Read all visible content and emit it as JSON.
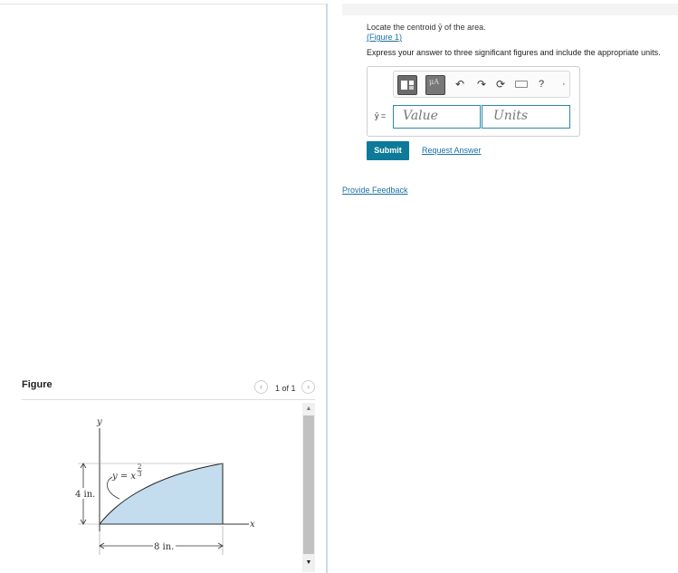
{
  "question": {
    "prompt": "Locate the centroid ȳ of the area.",
    "figure_link": "(Figure 1)",
    "instruction": "Express your answer to three significant figures and include the appropriate units."
  },
  "answer": {
    "variable_label": "ȳ =",
    "value_placeholder": "Value",
    "units_placeholder": "Units",
    "toolbar": {
      "template_icon": "templates-icon",
      "mu_label": "μA",
      "undo_icon": "undo-icon",
      "redo_icon": "redo-icon",
      "reset_icon": "reset-icon",
      "keyboard_icon": "keyboard-icon",
      "help_label": "?"
    }
  },
  "actions": {
    "submit_label": "Submit",
    "request_answer_label": "Request Answer",
    "provide_feedback_label": "Provide Feedback"
  },
  "figure_panel": {
    "title": "Figure",
    "page_label": "1 of 1",
    "prev_icon": "chevron-left-icon",
    "next_icon": "chevron-right-icon",
    "diagram": {
      "y_axis_label": "y",
      "x_axis_label": "x",
      "curve_equation_base": "y = x",
      "curve_equation_exp_num": "2",
      "curve_equation_exp_den": "3",
      "height_label": "4 in.",
      "width_label": "8 in.",
      "fill_color": "#c3dcee"
    }
  }
}
